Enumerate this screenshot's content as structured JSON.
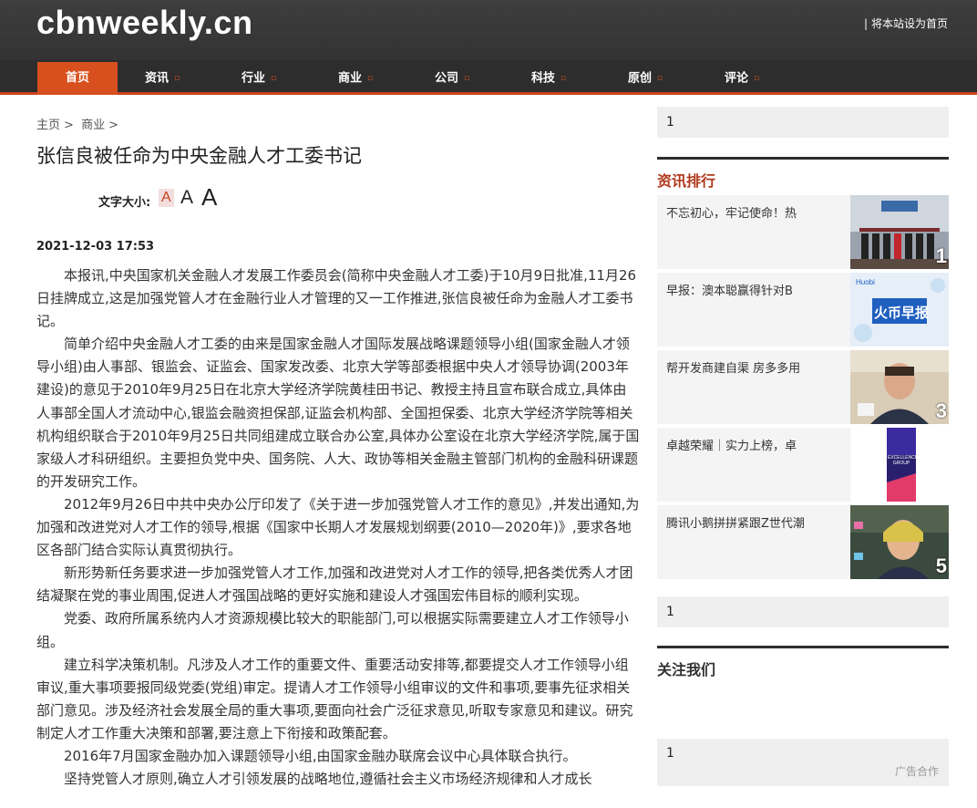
{
  "site": {
    "logo": "cbnweekly.cn",
    "set_home": "将本站设为首页",
    "set_home_sep": "|"
  },
  "nav": {
    "items": [
      {
        "label": "首页",
        "caret": ""
      },
      {
        "label": "资讯",
        "caret": "▫"
      },
      {
        "label": "行业",
        "caret": "▫"
      },
      {
        "label": "商业",
        "caret": "▫"
      },
      {
        "label": "公司",
        "caret": "▫"
      },
      {
        "label": "科技",
        "caret": "▫"
      },
      {
        "label": "原创",
        "caret": "▫"
      },
      {
        "label": "评论",
        "caret": "▫"
      }
    ]
  },
  "breadcrumb": {
    "home": "主页",
    "sep": ">",
    "section": "商业",
    "sep2": ">"
  },
  "article": {
    "title": "张信良被任命为中央金融人才工委书记",
    "font_size_label": "文字大小:",
    "font_size_options": [
      "A",
      "A",
      "A"
    ],
    "date": "2021-12-03 17:53",
    "paragraphs": [
      "本报讯,中央国家机关金融人才发展工作委员会(简称中央金融人才工委)于10月9日批准,11月26日挂牌成立,这是加强党管人才在金融行业人才管理的又一工作推进,张信良被任命为金融人才工委书记。",
      "简单介绍中央金融人才工委的由来是国家金融人才国际发展战略课题领导小组(国家金融人才领导小组)由人事部、银监会、证监会、国家发改委、北京大学等部委根据中央人才领导协调(2003年建设)的意见于2010年9月25日在北京大学经济学院黄桂田书记、教授主持且宣布联合成立,具体由人事部全国人才流动中心,银监会融资担保部,证监会机构部、全国担保委、北京大学经济学院等相关机构组织联合于2010年9月25日共同组建成立联合办公室,具体办公室设在北京大学经济学院,属于国家级人才科研组织。主要担负党中央、国务院、人大、政协等相关金融主管部门机构的金融科研课题的开发研究工作。",
      "2012年9月26日中共中央办公厅印发了《关于进一步加强党管人才工作的意见》,并发出通知,为加强和改进党对人才工作的领导,根据《国家中长期人才发展规划纲要(2010—2020年)》,要求各地区各部门结合实际认真贯彻执行。",
      "新形势新任务要求进一步加强党管人才工作,加强和改进党对人才工作的领导,把各类优秀人才团结凝聚在党的事业周围,促进人才强国战略的更好实施和建设人才强国宏伟目标的顺利实现。",
      "党委、政府所属系统内人才资源规模比较大的职能部门,可以根据实际需要建立人才工作领导小组。",
      "建立科学决策机制。凡涉及人才工作的重要文件、重要活动安排等,都要提交人才工作领导小组审议,重大事项要报同级党委(党组)审定。提请人才工作领导小组审议的文件和事项,要事先征求相关部门意见。涉及经济社会发展全局的重大事项,要面向社会广泛征求意见,听取专家意见和建议。研究制定人才工作重大决策和部署,要注意上下衔接和政策配套。",
      "2016年7月国家金融办加入课题领导小组,由国家金融办联席会议中心具体联合执行。",
      "坚持党管人才原则,确立人才引领发展的战略地位,遵循社会主义市场经济规律和人才成长"
    ]
  },
  "sidebar": {
    "box1": "1",
    "rank_title": "资讯排行",
    "rank_items": [
      {
        "text": "不忘初心，牢记使命！热",
        "num": "1"
      },
      {
        "text": "早报：澳本聪赢得针对B",
        "num": "",
        "thumb_text": "火币早报",
        "thumb_brand": "Huobi"
      },
      {
        "text": "帮开发商建自渠 房多多用",
        "num": "3"
      },
      {
        "text": "卓越荣耀｜实力上榜，卓",
        "num": "",
        "thumb_text": "EXCELLENCE GROUP"
      },
      {
        "text": "腾讯小鹅拼拼紧跟Z世代潮",
        "num": "5"
      }
    ],
    "box2": "1",
    "follow_title": "关注我们",
    "box3": "1",
    "ad_label": "广告合作"
  },
  "colors": {
    "accent": "#d9501f",
    "header_bg": "#333333",
    "rank_title": "#b0391b"
  }
}
